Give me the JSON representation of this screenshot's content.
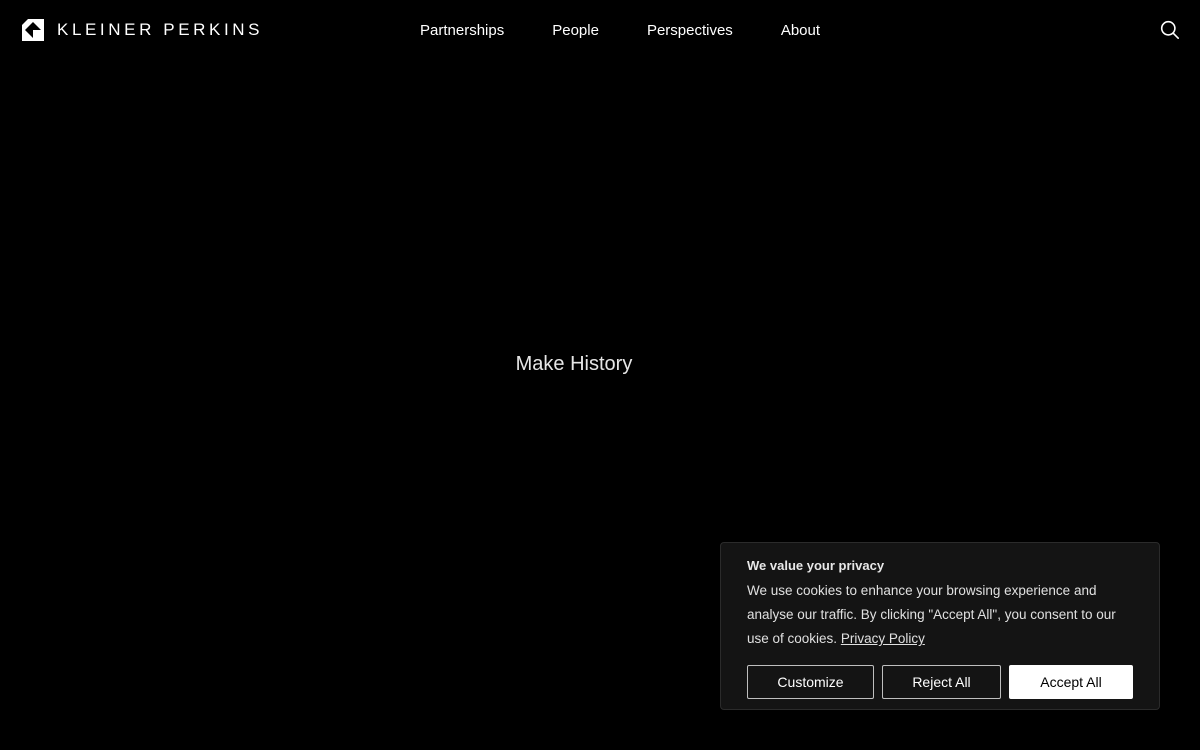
{
  "header": {
    "logo_text": "KLEINER PERKINS",
    "nav": {
      "partnerships": "Partnerships",
      "people": "People",
      "perspectives": "Perspectives",
      "about": "About"
    },
    "search_icon": "search-icon"
  },
  "hero": {
    "title": "Make History"
  },
  "cookie_banner": {
    "title": "We value your privacy",
    "body": "We use cookies to enhance your browsing experience and analyse our traffic. By clicking \"Accept All\", you consent to our use of cookies.",
    "link_text": "Privacy Policy",
    "buttons": {
      "customize": "Customize",
      "reject": "Reject All",
      "accept": "Accept All"
    }
  },
  "colors": {
    "background": "#000000",
    "text": "#ffffff",
    "banner_background": "#141414",
    "accept_button": "#ffffff"
  }
}
